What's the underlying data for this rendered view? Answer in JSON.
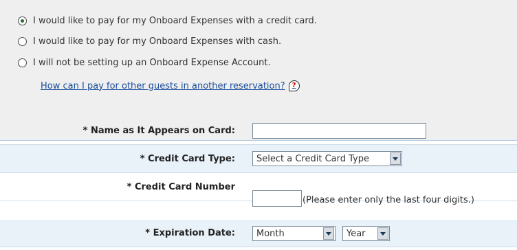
{
  "payment_options": [
    {
      "label": "I would like to pay for my Onboard Expenses with a credit card.",
      "checked": true
    },
    {
      "label": "I would like to pay for my Onboard Expenses with cash.",
      "checked": false
    },
    {
      "label": "I will not be setting up an Onboard Expense Account.",
      "checked": false
    }
  ],
  "help_link": {
    "text": "How can I pay for other guests in another reservation?",
    "icon": "help-bubble-icon"
  },
  "form": {
    "name_label": "* Name as It Appears on Card:",
    "name_value": "",
    "card_type_label": "* Credit Card Type:",
    "card_type_value": "Select a Credit Card Type",
    "card_number_label": "* Credit Card Number",
    "card_number_value": "",
    "card_number_note": "(Please enter only the last four digits.)",
    "expiration_label": "* Expiration Date:",
    "month_value": "Month",
    "year_value": "Year"
  }
}
